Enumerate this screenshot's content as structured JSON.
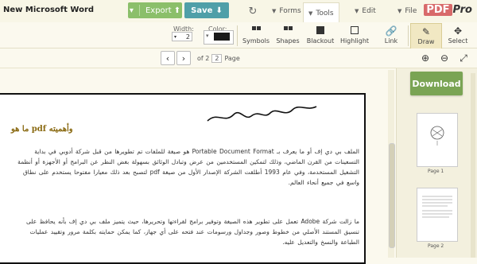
{
  "app": {
    "title": "New Microsoft Word",
    "logo_pdf": "PDF",
    "logo_pro": "Pro"
  },
  "menu": {
    "file": "File",
    "edit": "Edit",
    "tools": "Tools",
    "forms": "Forms"
  },
  "actions": {
    "save": "Save",
    "export": "Export"
  },
  "toolbar": {
    "select": "Select",
    "draw": "Draw",
    "link": "Link",
    "highlight": "Highlight",
    "blackout": "Blackout",
    "shapes": "Shapes",
    "symbols": "Symbols",
    "color_label": "Color:",
    "width_label": "Width:",
    "width_value": "2",
    "color_value": "#1a1a1a"
  },
  "nav": {
    "page_label": "Page",
    "page_current": "2",
    "page_of": "of 2"
  },
  "document": {
    "heading": "ما هو pdf وأهميته",
    "para1": "الملف بي دي إف أو ما يعرف بـ Portable Document Format هو صيغة للملفات تم تطويرها من قبل شركة أدوبي في بداية التسعينات من القرن الماضي، وذلك لتمكين المستخدمين من عرض وتبادل الوثائق بسهولة بغض النظر عن البرامج أو الأجهزة أو أنظمة التشغيل المستخدمة، وفي عام 1993 أطلقت الشركة الإصدار الأول من صيغة pdf لتصبح بعد ذلك معيارا مفتوحا يستخدم على نطاق واسع في جميع أنحاء العالم.",
    "para2": "ما زالت شركة Adobe تعمل على تطوير هذه الصيغة وتوفير برامج لقراءتها وتحريرها، حيث يتميز ملف بي دي إف بأنه يحافظ على تنسيق المستند الأصلي من خطوط وصور وجداول ورسومات عند فتحه على أي جهاز، كما يمكن حمايته بكلمة مرور وتقييد عمليات الطباعة والنسخ والتعديل عليه."
  },
  "sidebar": {
    "download": "Download",
    "page1": "Page 1",
    "page2": "Page 2"
  }
}
